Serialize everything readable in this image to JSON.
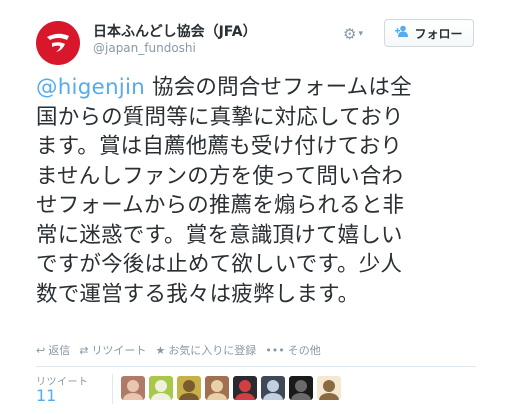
{
  "account": {
    "full_name": "日本ふんどし協会（JFA）",
    "screen_name": "@japan_fundoshi",
    "avatar_icon": "jfa-logo-icon"
  },
  "header": {
    "settings_icon": "gear-icon",
    "follow_label": "フォロー"
  },
  "tweet": {
    "mention": "@higenjin",
    "lines": [
      " 協会の問合せフォームは全",
      "国からの質問等に真摯に対応しており",
      "ます。賞は自薦他薦も受け付けており",
      "ませんしファンの方を使って問い合わ",
      "せフォームからの推薦を煽られると非",
      "常に迷惑です。賞を意識頂けて嬉しい",
      "ですが今後は止めて欲しいです。少人",
      "数で運営する我々は疲弊します。"
    ]
  },
  "actions": {
    "reply": "返信",
    "retweet": "リツイート",
    "favorite": "お気に入りに登録",
    "more": "その他"
  },
  "stats": {
    "retweet_label": "リツイート",
    "retweet_count": "11"
  },
  "colors": {
    "accent": "#55acee",
    "brand": "#d8182a",
    "muted": "#8899a6"
  },
  "retweeter_avatars": [
    {
      "bg": "#b07a6a",
      "fg": "#e8c6b0"
    },
    {
      "bg": "#a8c84a",
      "fg": "#f0f0e0"
    },
    {
      "bg": "#c8b048",
      "fg": "#7a5a30"
    },
    {
      "bg": "#a07050",
      "fg": "#e8d0a8"
    },
    {
      "bg": "#2a2a30",
      "fg": "#d04040"
    },
    {
      "bg": "#404858",
      "fg": "#c0d0e0"
    },
    {
      "bg": "#1a1a1a",
      "fg": "#6a6a6a"
    },
    {
      "bg": "#f4e8d0",
      "fg": "#8a6a40"
    }
  ]
}
